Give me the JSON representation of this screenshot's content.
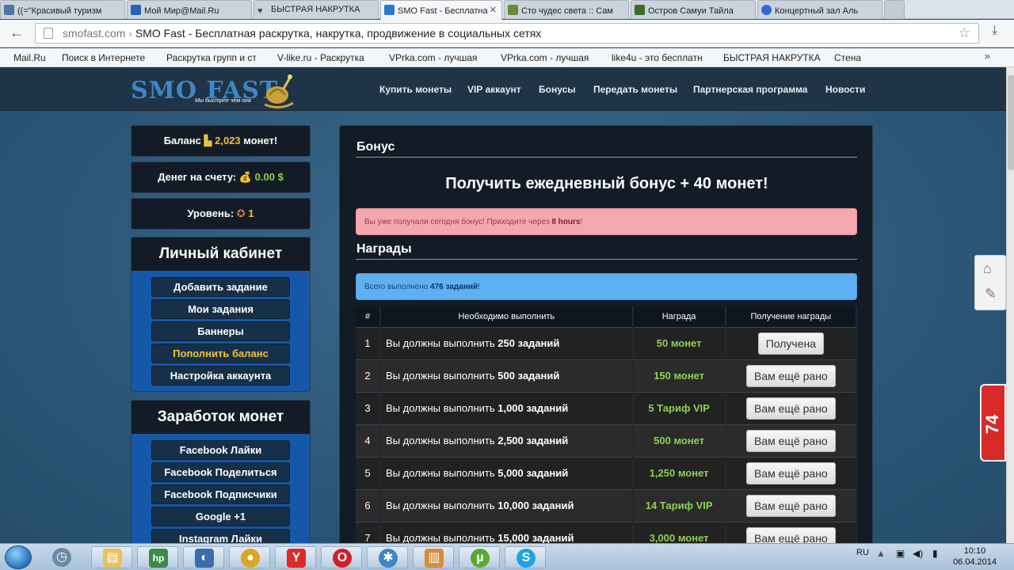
{
  "browser": {
    "tabs": [
      {
        "label": "((=\"Красивый туризм",
        "icon": "vk-icon",
        "color": "#4a76a8"
      },
      {
        "label": "Мой Мир@Mail.Ru",
        "icon": "mailru-icon",
        "color": "#2a63b3"
      },
      {
        "label": "БЫСТРАЯ НАКРУТКА",
        "icon": "heart-icon",
        "color": "#444"
      },
      {
        "label": "SMO Fast - Бесплатна",
        "icon": "smofast-icon",
        "color": "#2a7ad1",
        "active": true
      },
      {
        "label": "Сто чудес света :: Сам",
        "icon": "photo-icon",
        "color": "#6a8a3a"
      },
      {
        "label": "Остров Самуи Тайла",
        "icon": "photo-icon",
        "color": "#3b6b2a"
      },
      {
        "label": "Концертный зал Аль",
        "icon": "globe-icon",
        "color": "#3367d6"
      }
    ],
    "url_domain": "smofast.com",
    "url_title": "SMO Fast - Бесплатная раскрутка, накрутка, продвижение в социальных сетях",
    "bookmarks": [
      "Mail.Ru",
      "Поиск в Интернете",
      "Раскрутка групп и ст",
      "V-like.ru - Раскрутка",
      "VPrka.com - лучшая",
      "VPrka.com - лучшая",
      "like4u - это бесплатн",
      "БЫСТРАЯ НАКРУТКА",
      "Стена"
    ],
    "bookmarks_more": "»"
  },
  "site": {
    "logo": "SMO FAST",
    "logo_tagline": "Мы быстрее чем она",
    "nav": [
      "Купить монеты",
      "VIP аккаунт",
      "Бонусы",
      "Передать монеты",
      "Партнерская программа",
      "Новости"
    ],
    "balance": {
      "label": "Баланс",
      "value": "2,023",
      "suffix": "монет!"
    },
    "money": {
      "label": "Денег на счету:",
      "value": "0.00 $"
    },
    "level": {
      "label": "Уровень:",
      "value": "1"
    },
    "cabinet": {
      "title": "Личный кабинет",
      "items": [
        "Добавить задание",
        "Мои задания",
        "Баннеры",
        "Пополнить баланс",
        "Настройка аккаунта"
      ]
    },
    "earn": {
      "title": "Заработок монет",
      "items": [
        "Facebook Лайки",
        "Facebook Поделиться",
        "Facebook Подписчики",
        "Google +1",
        "Instagram Лайки"
      ]
    },
    "bonus": {
      "section_title": "Бонус",
      "headline": "Получить ежедневный бонус + 40 монет!",
      "alert_text": "Вы уже получали сегодня бонус! Приходите через",
      "alert_time": "8 hours",
      "alert_end": "!"
    },
    "rewards": {
      "section_title": "Награды",
      "info_prefix": "Всего выполнено",
      "info_value": "476 заданий",
      "info_suffix": "!",
      "columns": [
        "#",
        "Необходимо выполнить",
        "Награда",
        "Получение награды"
      ],
      "rows": [
        {
          "n": "1",
          "prefix": "Вы должны выполнить",
          "count": "250 заданий",
          "reward": "50 монет",
          "action": "Получена"
        },
        {
          "n": "2",
          "prefix": "Вы должны выполнить",
          "count": "500 заданий",
          "reward": "150 монет",
          "action": "Вам ещё рано"
        },
        {
          "n": "3",
          "prefix": "Вы должны выполнить",
          "count": "1,000 заданий",
          "reward": "5 Тариф VIP",
          "action": "Вам ещё рано"
        },
        {
          "n": "4",
          "prefix": "Вы должны выполнить",
          "count": "2,500 заданий",
          "reward": "500 монет",
          "action": "Вам ещё рано"
        },
        {
          "n": "5",
          "prefix": "Вы должны выполнить",
          "count": "5,000 заданий",
          "reward": "1,250 монет",
          "action": "Вам ещё рано"
        },
        {
          "n": "6",
          "prefix": "Вы должны выполнить",
          "count": "10,000 заданий",
          "reward": "14 Тариф VIP",
          "action": "Вам ещё рано"
        },
        {
          "n": "7",
          "prefix": "Вы должны выполнить",
          "count": "15,000 заданий",
          "reward": "3,000 монет",
          "action": "Вам ещё рано"
        }
      ]
    },
    "side_counter": "74"
  },
  "taskbar": {
    "lang": "RU",
    "time": "10:10",
    "date": "06.04.2014",
    "apps": [
      {
        "name": "task-manager-icon",
        "color": "#6b8aa6",
        "glyph": "◷"
      },
      {
        "name": "explorer-icon",
        "color": "#e8c15a",
        "glyph": "▤"
      },
      {
        "name": "hp-icon",
        "color": "#3a8a4a",
        "glyph": "hp"
      },
      {
        "name": "network-icon",
        "color": "#3b6ea8",
        "glyph": "◐"
      },
      {
        "name": "chrome-icon",
        "color": "#d9a81f",
        "glyph": "●"
      },
      {
        "name": "yandex-icon",
        "color": "#e02a2a",
        "glyph": "Y"
      },
      {
        "name": "opera-icon",
        "color": "#d0202a",
        "glyph": "O"
      },
      {
        "name": "safari-icon",
        "color": "#3b86c9",
        "glyph": "✱"
      },
      {
        "name": "folder-icon",
        "color": "#d98c3a",
        "glyph": "▥"
      },
      {
        "name": "utorrent-icon",
        "color": "#5aa832",
        "glyph": "µ"
      },
      {
        "name": "skype-icon",
        "color": "#1fa3e0",
        "glyph": "S"
      }
    ]
  }
}
